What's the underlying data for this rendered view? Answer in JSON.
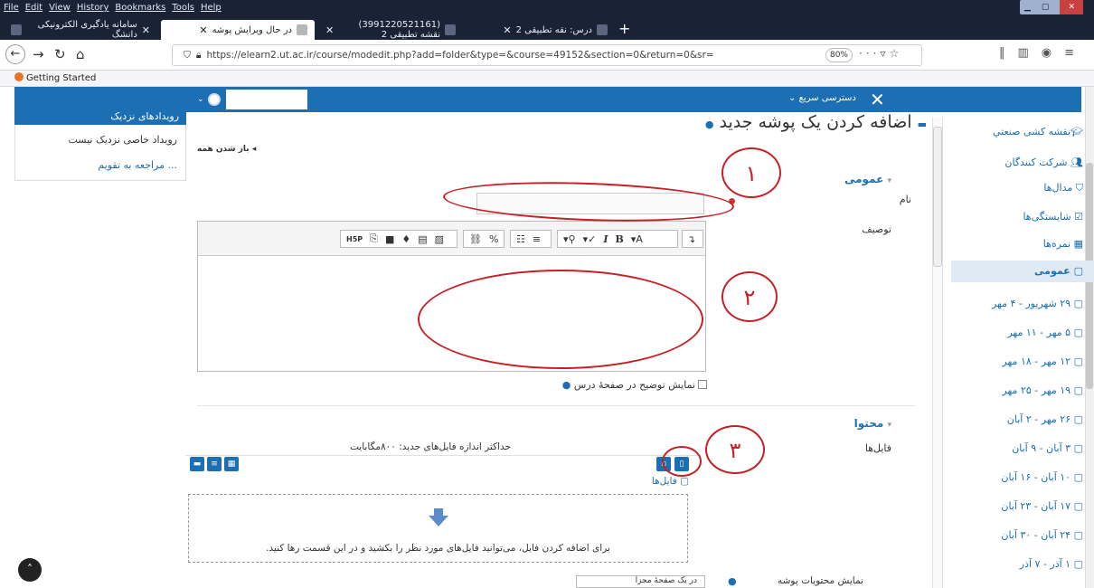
{
  "menu": [
    "File",
    "Edit",
    "View",
    "History",
    "Bookmarks",
    "Tools",
    "Help"
  ],
  "tabs": [
    {
      "label": "سامانه یادگیری الکترونیکی دانشگ"
    },
    {
      "label": "در حال ویرایش پوشه"
    },
    {
      "label": "(3991220521161) نقشه تطبیقی 2"
    },
    {
      "label": "درس: نقه تطبیقی 2"
    }
  ],
  "url": "https://elearn2.ut.ac.ir/course/modedit.php?add=folder&type=&course=49152&section=0&return=0&sr=",
  "zoom": "80%",
  "bookmark": "Getting Started",
  "moodle_nav": {
    "quick_access": "دسترسی سریع"
  },
  "left_block": {
    "header": "رویدادهای نزدیک",
    "no_events": "رویداد خاصی نزدیک نیست",
    "go_to_calendar": "... مراجعه به تقویم"
  },
  "right_nav": [
    "نقشه کشی صنعتي",
    "شرکت کنندگان",
    "مدال‌ها",
    "شایستگی‌ها",
    "نمره‌ها",
    "عمومی",
    "۲۹ شهریور - ۴ مهر",
    "۵ مهر - ۱۱ مهر",
    "۱۲ مهر - ۱۸ مهر",
    "۱۹ مهر - ۲۵ مهر",
    "۲۶ مهر - ۲ آبان",
    "۳ آبان - ۹ آبان",
    "۱۰ آبان - ۱۶ آبان",
    "۱۷ آبان - ۲۳ آبان",
    "۲۴ آبان - ۳۰ آبان",
    "۱ آذر - ۷ آذر"
  ],
  "page": {
    "title": "اضافه کردن یک پوشه جدید",
    "expand_all": "باز شدن همه",
    "section_general": "عمومی",
    "label_name": "نام",
    "label_description": "توصیف",
    "show_description": "نمایش توضیح در صفحهٔ درس",
    "section_content": "محتوا",
    "label_files": "فایل‌ها",
    "max_size": "حداکثر اندازه فایل‌های جدید: ۸۰۰مگابایت",
    "folder_path": "فایل‌ها",
    "drop_text": "برای اضافه کردن فایل، می‌توانید فایل‌های مورد نظر را بکشید و در این قسمت رها کنید.",
    "label_display": "نمایش محتویات پوشه",
    "display_value": "در یک صفحهٔ مجزا"
  },
  "annotations": [
    "۱",
    "۲",
    "۳"
  ],
  "colors": {
    "accent": "#1b6fb2",
    "annotation": "#c62026",
    "tabbar": "#1a2236"
  }
}
